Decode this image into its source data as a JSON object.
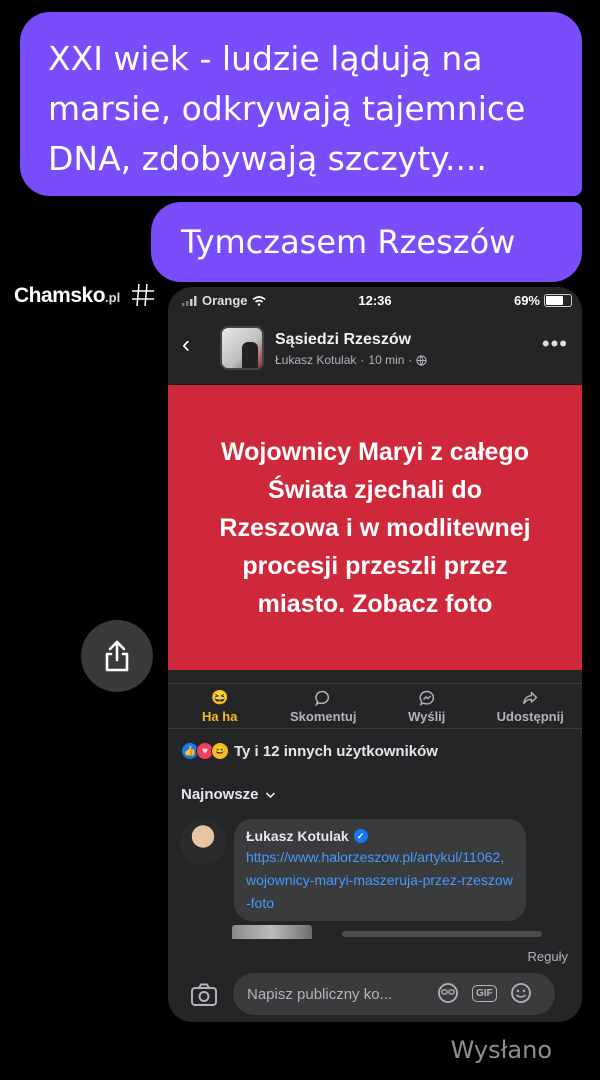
{
  "chat": {
    "message1": "XXI wiek - ludzie lądują na marsie, odkrywają tajemnice DNA, zdobywają szczyty....",
    "message2": "Tymczasem Rzeszów",
    "sent_status": "Wysłano"
  },
  "watermark": {
    "name": "Chamsko",
    "tld": ".pl"
  },
  "screenshot": {
    "status_bar": {
      "carrier": "Orange",
      "time": "12:36",
      "battery": "69%",
      "battery_level": 0.69
    },
    "post": {
      "group_name": "Sąsiedzi Rzeszów",
      "author": "Łukasz Kotulak",
      "time": "10 min",
      "image_text": "Wojownicy Maryi z całego Świata zjechali do Rzeszowa i w modlitewnej procesji przeszli przez miasto. Zobacz foto"
    },
    "actions": [
      {
        "label": "Ha ha",
        "icon": "haha-emoji-icon",
        "active": true
      },
      {
        "label": "Skomentuj",
        "icon": "comment-icon"
      },
      {
        "label": "Wyślij",
        "icon": "messenger-icon"
      },
      {
        "label": "Udostępnij",
        "icon": "share-arrow-icon"
      }
    ],
    "reactions_label": "Ty i 12 innych użytkowników",
    "sort_label": "Najnowsze",
    "comment": {
      "author": "Łukasz Kotulak",
      "text": "https://www.halorzeszow.pl/artykul/11062,wojownicy-maryi-maszeruja-przez-rzeszow-foto"
    },
    "rules_label": "Reguły",
    "composer_placeholder": "Napisz publiczny ko..."
  },
  "colors": {
    "bubble": "#7a4dfb",
    "post_banner": "#d0283b",
    "link": "#4599ff",
    "haha_active": "#f7b928"
  }
}
